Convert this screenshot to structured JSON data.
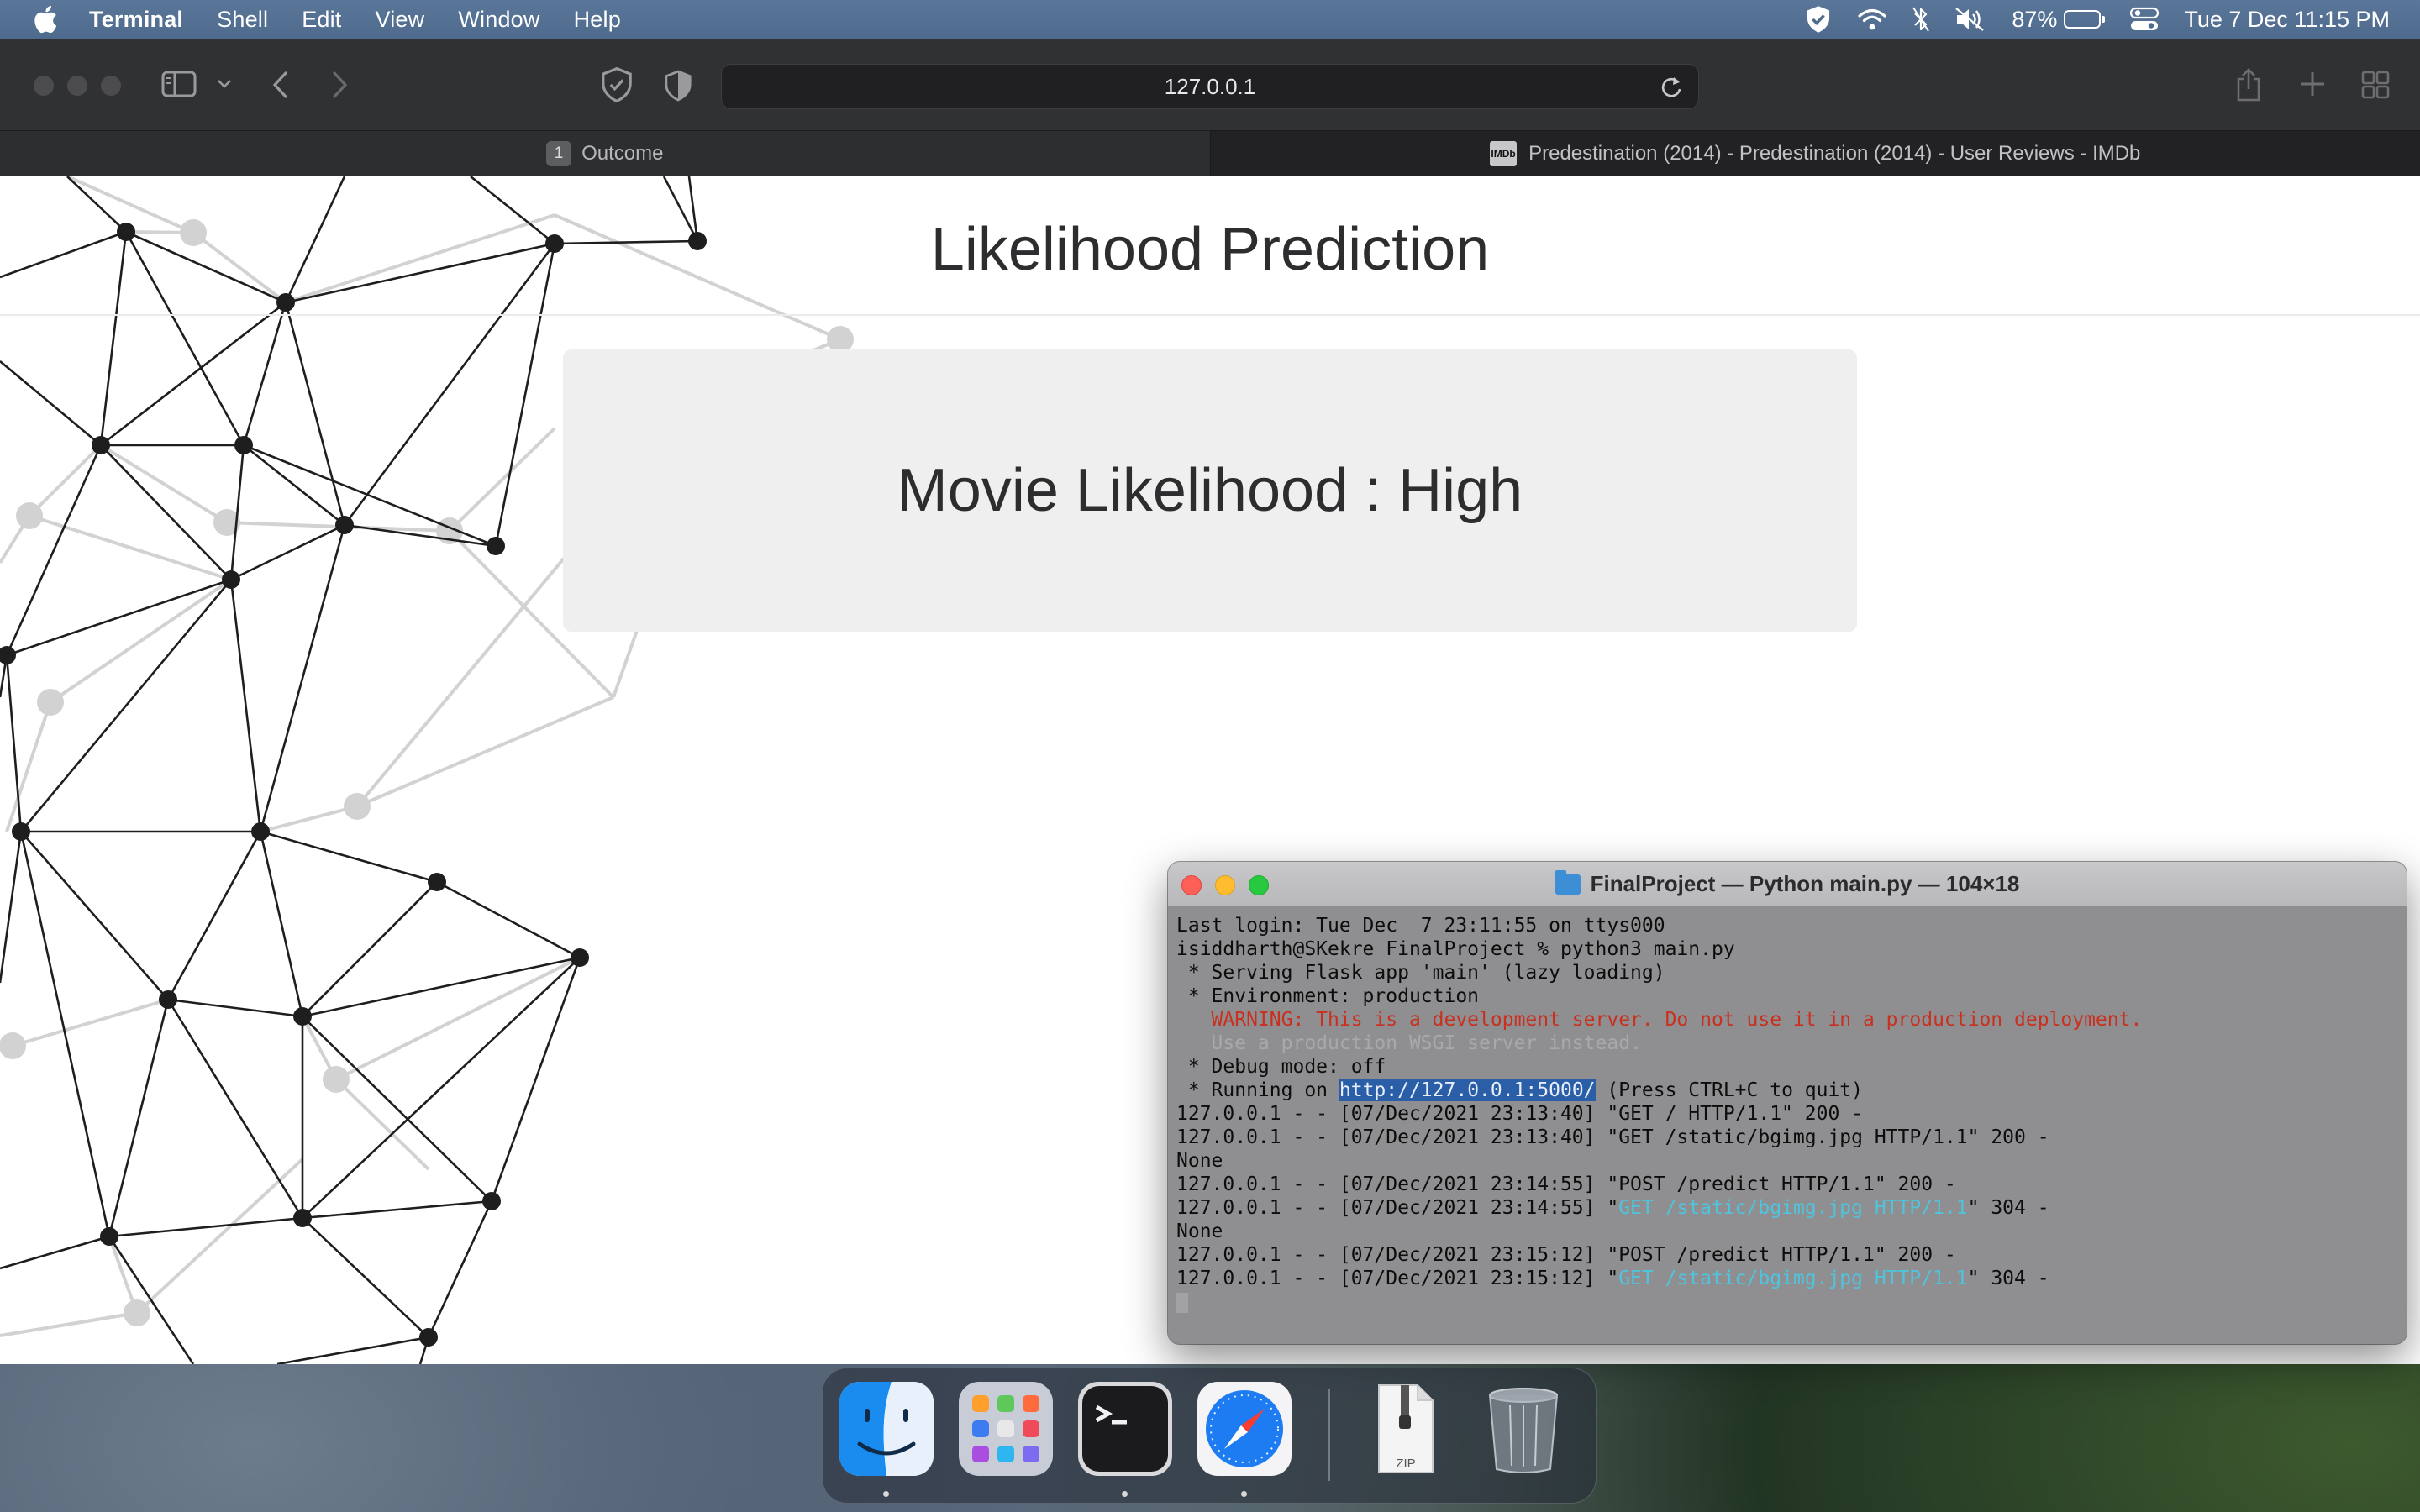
{
  "menubar": {
    "app_name": "Terminal",
    "menus": [
      "Shell",
      "Edit",
      "View",
      "Window",
      "Help"
    ],
    "battery_percent": "87%",
    "battery_level": 0.87,
    "datetime": "Tue 7 Dec  11:15 PM"
  },
  "browser": {
    "url": "127.0.0.1",
    "tabs": [
      {
        "number": "1",
        "title": "Outcome",
        "active": true
      },
      {
        "favicon_text": "IMDb",
        "title": "Predestination (2014) - Predestination (2014) - User Reviews - IMDb",
        "active": false
      }
    ]
  },
  "page": {
    "title": "Likelihood Prediction",
    "result": "Movie Likelihood : High"
  },
  "terminal": {
    "window_title": "FinalProject — Python main.py — 104×18",
    "lines": {
      "l1": "Last login: Tue Dec  7 23:11:55 on ttys000",
      "l2": "isiddharth@SKekre FinalProject % python3 main.py",
      "l3": " * Serving Flask app 'main' (lazy loading)",
      "l4": " * Environment: production",
      "l5": "   WARNING: This is a development server. Do not use it in a production deployment.",
      "l6": "   Use a production WSGI server instead.",
      "l7": " * Debug mode: off",
      "l8a": " * Running on ",
      "l8b": "http://127.0.0.1:5000/",
      "l8c": " (Press CTRL+C to quit)",
      "l9": "127.0.0.1 - - [07/Dec/2021 23:13:40] \"GET / HTTP/1.1\" 200 -",
      "l10": "127.0.0.1 - - [07/Dec/2021 23:13:40] \"GET /static/bgimg.jpg HTTP/1.1\" 200 -",
      "l11": "None",
      "l12": "127.0.0.1 - - [07/Dec/2021 23:14:55] \"POST /predict HTTP/1.1\" 200 -",
      "l13a": "127.0.0.1 - - [07/Dec/2021 23:14:55] \"",
      "l13b": "GET /static/bgimg.jpg HTTP/1.1",
      "l13c": "\" 304 -",
      "l14": "None",
      "l15": "127.0.0.1 - - [07/Dec/2021 23:15:12] \"POST /predict HTTP/1.1\" 200 -",
      "l16a": "127.0.0.1 - - [07/Dec/2021 23:15:12] \"",
      "l16b": "GET /static/bgimg.jpg HTTP/1.1",
      "l16c": "\" 304 -"
    }
  },
  "dock": {
    "apps": [
      "Finder",
      "Launchpad",
      "Terminal",
      "Safari",
      "Archive (ZIP)",
      "Trash"
    ],
    "zip_label": "ZIP"
  },
  "colors": {
    "warning_text": "#c9301f",
    "link_text": "#4fc4dc",
    "selection": "#2a5ea6"
  }
}
